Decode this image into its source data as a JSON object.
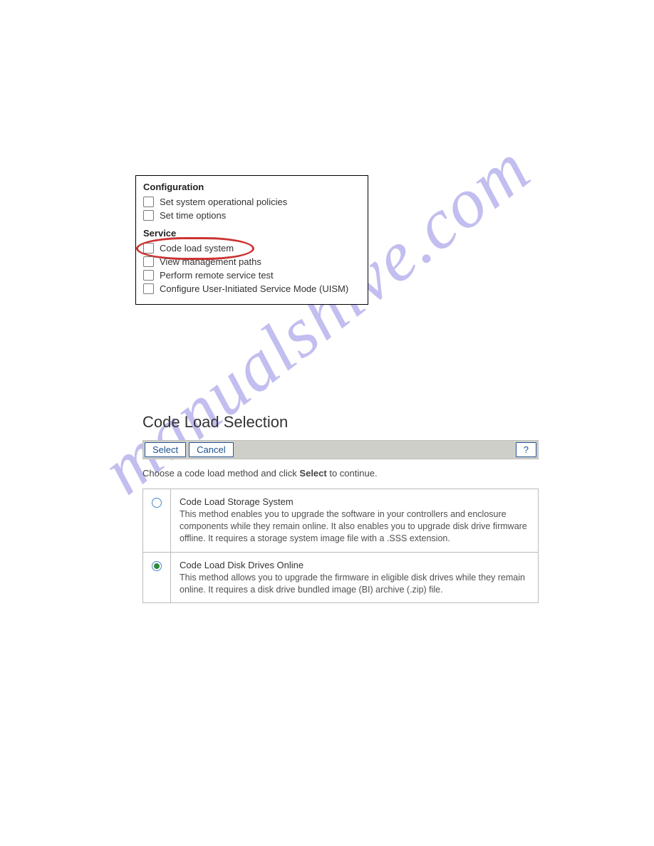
{
  "panel1": {
    "configuration": {
      "title": "Configuration",
      "items": [
        {
          "label": "Set system operational policies"
        },
        {
          "label": "Set time options"
        }
      ]
    },
    "service": {
      "title": "Service",
      "items": [
        {
          "label": "Code load system",
          "circled": true
        },
        {
          "label": "View management paths"
        },
        {
          "label": "Perform remote service test"
        },
        {
          "label": "Configure User-Initiated Service Mode (UISM)"
        }
      ]
    }
  },
  "panel2": {
    "title": "Code Load Selection",
    "toolbar": {
      "select_label": "Select",
      "cancel_label": "Cancel",
      "help_label": "?"
    },
    "instructions_prefix": "Choose a code load method and click ",
    "instructions_bold": "Select",
    "instructions_suffix": " to continue.",
    "options": [
      {
        "selected": false,
        "title": "Code Load Storage System",
        "desc": "This method enables you to upgrade the software in your controllers and enclosure components while they remain online. It also enables you to upgrade disk drive firmware offline. It requires a storage system image file with a .SSS extension."
      },
      {
        "selected": true,
        "title": "Code Load Disk Drives Online",
        "desc": "This method allows you to upgrade the firmware in eligible disk drives while they remain online. It requires a disk drive bundled image (BI) archive (.zip) file."
      }
    ]
  },
  "watermark": "manualshive.com"
}
